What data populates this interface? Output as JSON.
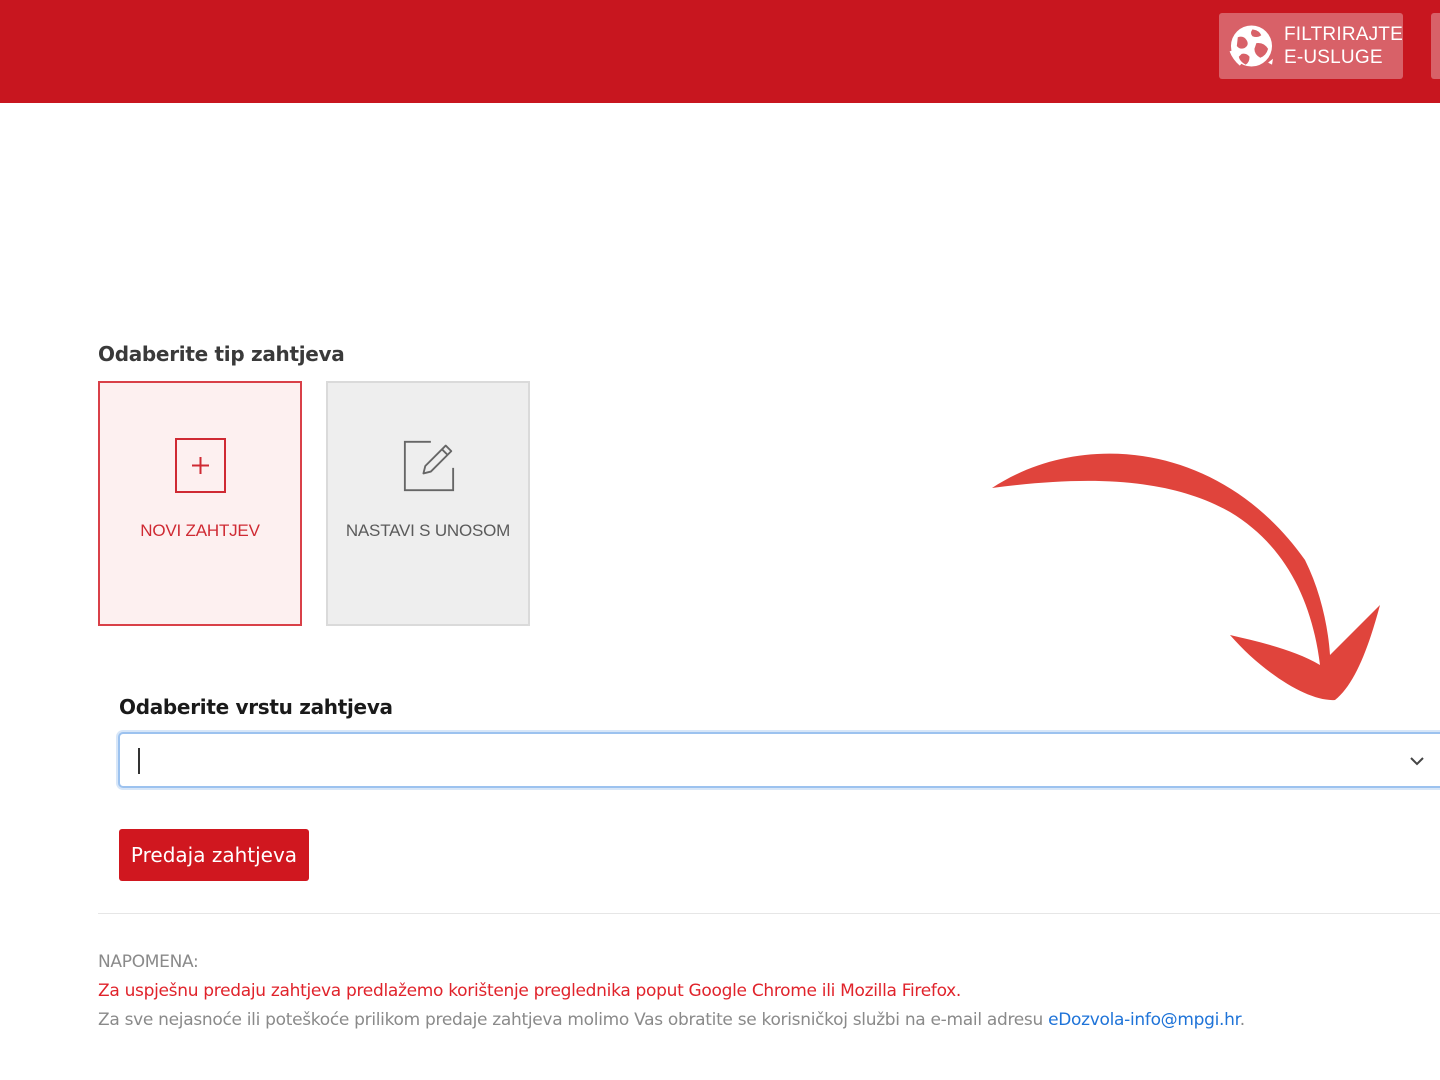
{
  "header": {
    "filter_button": {
      "line1": "FILTRIRAJTE",
      "line2": "E-USLUGE",
      "icon": "globe-icon"
    }
  },
  "request_type": {
    "title": "Odaberite tip zahtjeva",
    "tiles": [
      {
        "label": "NOVI ZAHTJEV",
        "icon": "plus-square-icon",
        "selected": true
      },
      {
        "label": "NASTAVI S UNOSOM",
        "icon": "edit-icon",
        "selected": false
      }
    ]
  },
  "request_kind": {
    "label": "Odaberite vrstu zahtjeva",
    "value": ""
  },
  "submit_label": "Predaja zahtjeva",
  "note": {
    "title": "NAPOMENA:",
    "browser_tip": "Za uspješnu predaju zahtjeva predlažemo korištenje preglednika poput Google Chrome ili Mozilla Firefox.",
    "support_text": "Za sve nejasnoće ili poteškoće prilikom predaje zahtjeva molimo Vas obratite se korisničkoj službi na e-mail adresu ",
    "support_email": "eDozvola-info@mpgi.hr",
    "trailing": "."
  },
  "colors": {
    "brand_red": "#c8161f",
    "button_red": "#d0171f",
    "link_blue": "#1e73d8",
    "arrow_red": "#e0443c"
  }
}
